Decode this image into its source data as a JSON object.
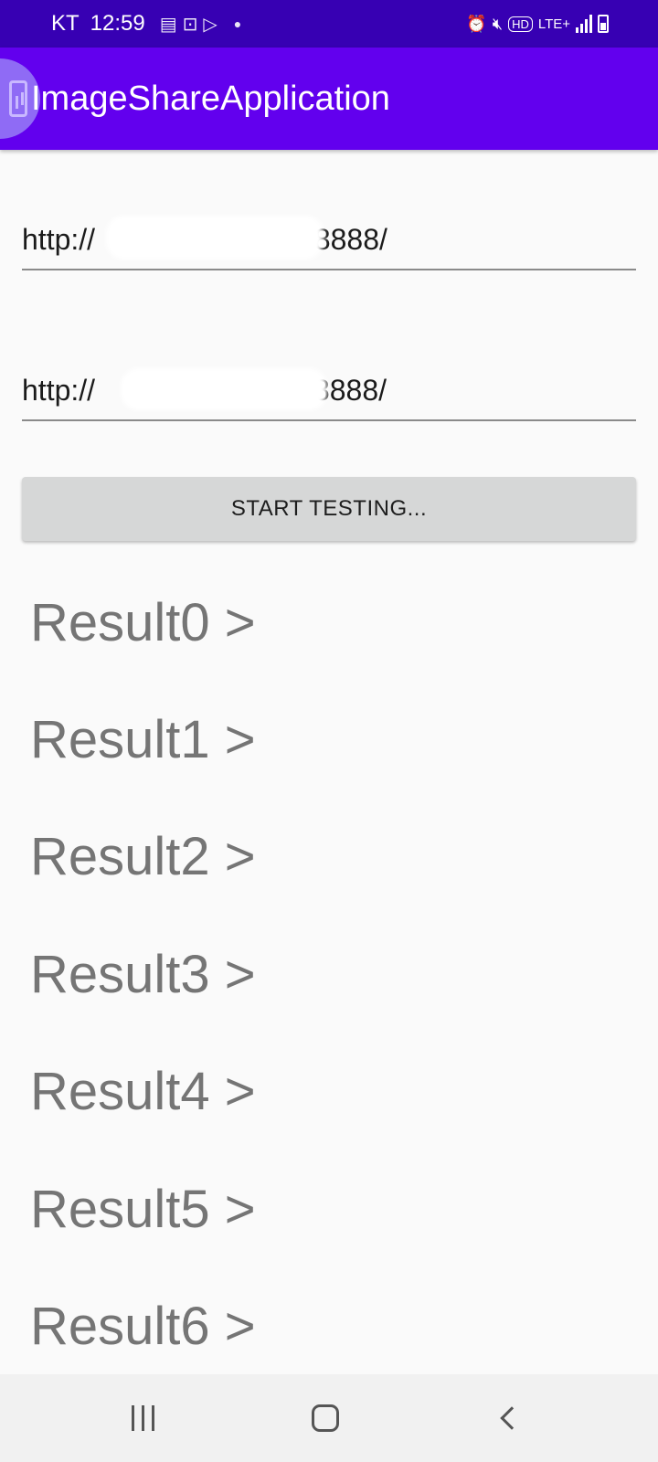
{
  "status_bar": {
    "carrier": "KT",
    "time": "12:59",
    "left_icons": [
      "sim-icon",
      "voicemail-icon",
      "play-store-icon",
      "dot-icon"
    ],
    "right_icons": [
      "alarm-icon",
      "mute-icon",
      "hd-icon",
      "lte-icon",
      "signal-icon",
      "battery-icon"
    ],
    "hd_label": "HD",
    "lte_label": "LTE+"
  },
  "app_bar": {
    "title": "ImageShareApplication",
    "background": "#6200ee",
    "status_background": "#3700b3"
  },
  "fields": [
    {
      "prefix": "http://",
      "suffix": "/:8888/"
    },
    {
      "prefix": "http://",
      "suffix": ":8888/"
    }
  ],
  "button": {
    "label": "START TESTING..."
  },
  "results": [
    "Result0 >",
    "Result1 >",
    "Result2 >",
    "Result3 >",
    "Result4 >",
    "Result5 >",
    "Result6 >"
  ],
  "nav_bar": {
    "buttons": [
      "recents-icon",
      "home-icon",
      "back-icon"
    ]
  }
}
